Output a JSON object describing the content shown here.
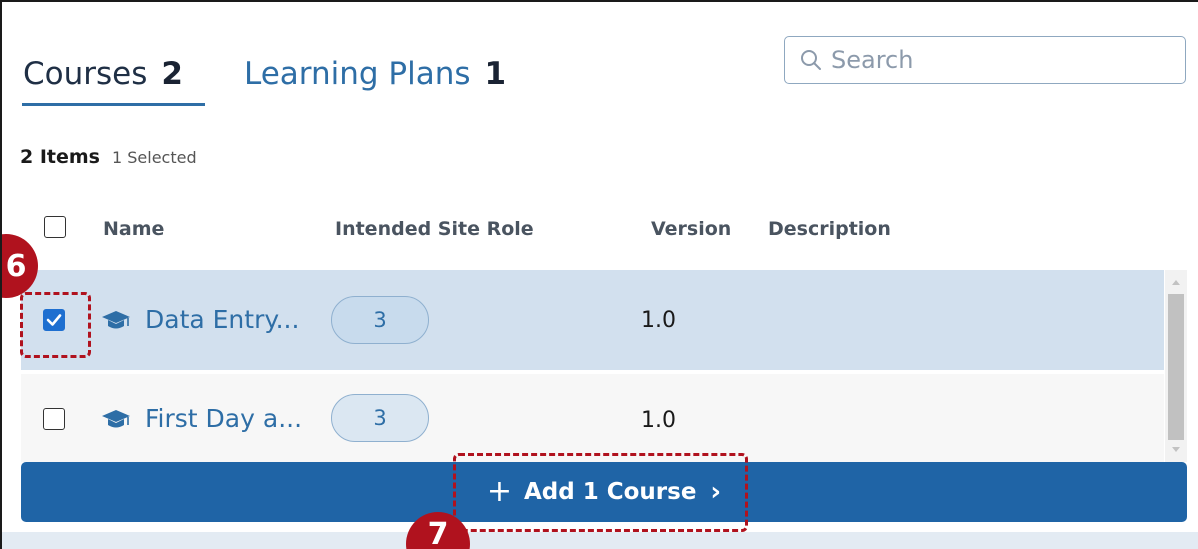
{
  "tabs": [
    {
      "label": "Courses",
      "count": "2",
      "active": true
    },
    {
      "label": "Learning Plans",
      "count": "1",
      "active": false
    }
  ],
  "search": {
    "placeholder": "Search"
  },
  "list_summary": {
    "items_label": "2 Items",
    "selected_label": "1 Selected"
  },
  "table": {
    "headers": {
      "name": "Name",
      "role": "Intended Site Role",
      "version": "Version",
      "description": "Description"
    },
    "rows": [
      {
        "name": "Data Entry...",
        "role_count": "3",
        "version": "1.0",
        "description": "",
        "selected": true
      },
      {
        "name": "First Day a...",
        "role_count": "3",
        "version": "1.0",
        "description": "",
        "selected": false
      }
    ]
  },
  "add_bar": {
    "plus": "+",
    "label": "Add 1 Course",
    "chevron": "›"
  },
  "annotations": {
    "step_6": "6",
    "step_7": "7"
  },
  "colors": {
    "accent": "#2e6ea6",
    "selected_row": "#d2e0ee",
    "primary_bar": "#1f64a6",
    "checkbox": "#1e6fd0",
    "callout": "#b0121e"
  },
  "icons": {
    "search": "search-icon",
    "course": "graduation-cap-icon",
    "check": "check-icon",
    "chevron": "chevron-right-icon"
  }
}
